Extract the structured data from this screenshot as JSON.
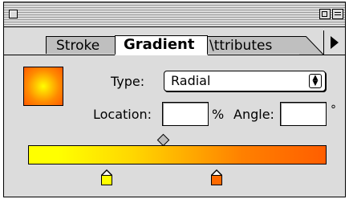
{
  "window": {
    "title": ""
  },
  "tabs": [
    {
      "label": "Stroke"
    },
    {
      "label": "Gradient"
    },
    {
      "label": "\\ttributes"
    }
  ],
  "gradient": {
    "type_label": "Type:",
    "type_value": "Radial",
    "location_label": "Location:",
    "location_value": "",
    "percent_symbol": "%",
    "angle_label": "Angle:",
    "angle_value": "",
    "degree_symbol": "°",
    "stops": [
      {
        "color": "#ffff00"
      },
      {
        "color": "#ff6a00"
      }
    ]
  },
  "icons": {
    "close": "close-box-icon",
    "zoom": "zoom-box-icon",
    "collapse": "collapse-box-icon",
    "flyout": "triangle-right-icon",
    "select_arrows": "up-down-arrows-icon",
    "midpoint": "diamond-icon"
  }
}
